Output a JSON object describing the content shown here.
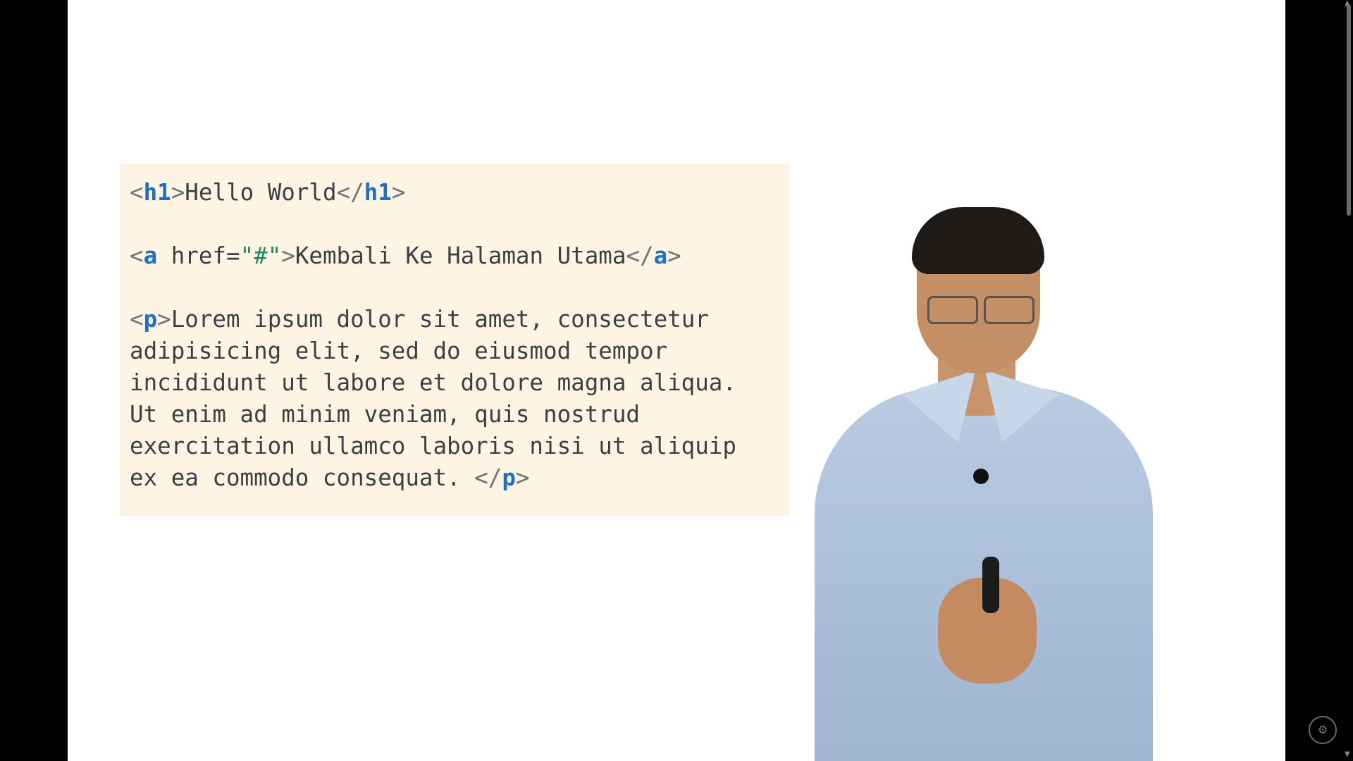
{
  "code": {
    "line1": {
      "open_lt": "<",
      "open_tag": "h1",
      "open_gt": ">",
      "text": "Hello World",
      "close_lt": "</",
      "close_tag": "h1",
      "close_gt": ">"
    },
    "line2": {
      "open_lt": "<",
      "open_tag": "a",
      "attr": " href=",
      "attr_value": "\"#\"",
      "open_gt": ">",
      "text": "Kembali Ke Halaman Utama",
      "close_lt": "</",
      "close_tag": "a",
      "close_gt": ">"
    },
    "paragraph": {
      "open_lt": "<",
      "open_tag": "p",
      "open_gt": ">",
      "lines": [
        "Lorem ipsum dolor sit amet, consectetur",
        "adipisicing elit, sed do eiusmod tempor",
        "incididunt ut labore et dolore magna aliqua.",
        "Ut enim ad minim veniam, quis nostrud",
        "exercitation ullamco laboris nisi ut aliquip",
        "ex ea commodo consequat. "
      ],
      "close_lt": "</",
      "close_tag": "p",
      "close_gt": ">"
    }
  },
  "colors": {
    "code_background": "#fdf4e3",
    "tag": "#1f6fc5",
    "string": "#1d8a63",
    "text": "#3b3f45"
  },
  "icons": {
    "scroll_up": "triangle-up-icon",
    "scroll_down": "triangle-down-icon",
    "watermark": "watermark-logo-icon"
  }
}
